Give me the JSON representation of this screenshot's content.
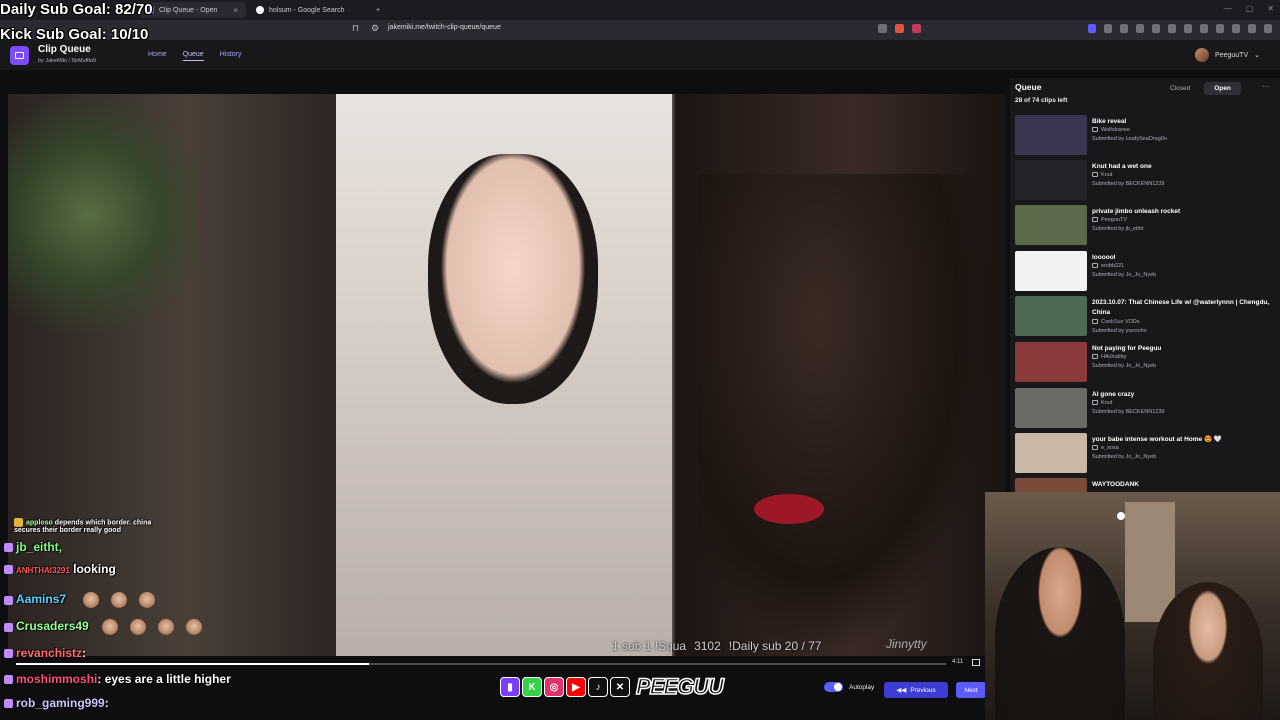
{
  "browser": {
    "tabs": [
      {
        "label": "Clip Queue - Open",
        "active": true
      },
      {
        "label": "holsum - Google Search",
        "active": false
      }
    ],
    "new_tab": "+",
    "url": "jakemiki.me/twitch-clip-queue/queue"
  },
  "app": {
    "title": "Clip Queue",
    "subtitle": "by JakeMiki / SirMuffin9",
    "nav": [
      "Home",
      "Queue",
      "History"
    ],
    "user": "PeeguuTV"
  },
  "overlay": {
    "daily_goal": "Daily Sub Goal: 82/70",
    "kick_goal": "Kick Sub Goal: 10/10",
    "clip_text": [
      "1 sub 1 !Squa",
      "3102",
      "!Daily sub 20 / 77"
    ],
    "watermark": "Jinnytty"
  },
  "player": {
    "time": "4:11",
    "progress": 0.38
  },
  "chat": [
    {
      "user": "apploso",
      "msg": "depends which border. china secures their border really good",
      "color": "#ffffff",
      "small": true
    },
    {
      "user": "jb_eitht,",
      "msg": "",
      "color": "#7cff7c"
    },
    {
      "user": "ANHTHAI3291",
      "msg": "looking",
      "color": "#ff5a5a"
    },
    {
      "user": "Aamins7",
      "msg": "",
      "color": "#5ad2ff"
    },
    {
      "user": "Crusaders49",
      "msg": "",
      "color": "#9aff9a"
    },
    {
      "user": "revanchistz",
      "msg": ":",
      "color": "#ff6b6b"
    },
    {
      "user": "moshimmoshi",
      "msg": ": eyes are a little higher",
      "color": "#ff4f7a"
    },
    {
      "user": "rob_gaming999",
      "msg": ":",
      "color": "#c8c8ff"
    }
  ],
  "queue": {
    "title": "Queue",
    "count": "28 of 74 clips left",
    "toggle": [
      "Closed",
      "Open"
    ],
    "more": "···",
    "items": [
      {
        "title": "Bike reveal",
        "channel": "Wolfsbanee",
        "submitted": "Submitted by LeafySeaDrag0n",
        "thumb": "#3a3550"
      },
      {
        "title": "Knut had a wet one",
        "channel": "Knut",
        "submitted": "Submitted by BECKENN1239",
        "thumb": "#222428"
      },
      {
        "title": "private jimbo unleash rocket",
        "channel": "PeeguuTV",
        "submitted": "Submitted by jb_eitht",
        "thumb": "#5b6a4a"
      },
      {
        "title": "loooool",
        "channel": "erobb221",
        "submitted": "Submitted by Jo_Jo_Nyeb",
        "thumb": "#f2f2f2"
      },
      {
        "title": "2023.10.07: That Chinese Life w/ @waterlynnn | Chengdu, China",
        "channel": "CookSux VODs",
        "submitted": "Submitted by yooooho",
        "thumb": "#4d6a53"
      },
      {
        "title": "Not paying for Peeguu",
        "channel": "HAchubby",
        "submitted": "Submitted by Jo_Jo_Nyeb",
        "thumb": "#8a3a3a"
      },
      {
        "title": "AI gone crazy",
        "channel": "Knut",
        "submitted": "Submitted by BECKENN1239",
        "thumb": "#6a6a66"
      },
      {
        "title": "your babe intense workout at Home 😍 🤍",
        "channel": "e_sosa",
        "submitted": "Submitted by Jo_Jo_Nyeb",
        "thumb": "#c9b8a5"
      },
      {
        "title": "WAYTOODANK",
        "channel": "",
        "submitted": "",
        "thumb": "#7a4a3a"
      }
    ]
  },
  "controls": {
    "autoplay": "Autoplay",
    "previous": "Previous",
    "next": "Next"
  },
  "brand": "PEEGUU",
  "colors": {
    "accent": "#5b5bff",
    "bg": "#0e0e10",
    "panel": "#18181b"
  }
}
